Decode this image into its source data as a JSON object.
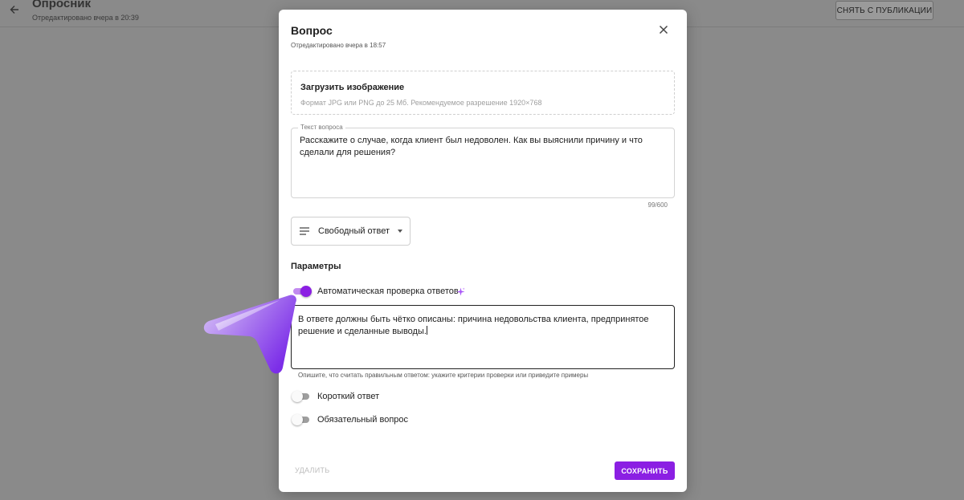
{
  "background": {
    "title": "Опросник",
    "subtitle": "Отредактировано вчера в 20:39",
    "unpublish_label": "СНЯТЬ С ПУБЛИКАЦИИ"
  },
  "modal": {
    "title": "Вопрос",
    "subtitle": "Отредактировано вчера в 18:57",
    "upload": {
      "title": "Загрузить изображение",
      "hint": "Формат JPG или PNG до 25 Мб. Рекомендуемое разрешение 1920×768"
    },
    "question": {
      "label": "Текст вопроса",
      "value": "Расскажите о случае, когда клиент был недоволен. Как вы выяснили причину и что сделали для решения?",
      "counter": "99/600"
    },
    "answer_type": {
      "icon": "lines-icon",
      "selected": "Свободный ответ"
    },
    "params": {
      "title": "Параметры",
      "auto_check": {
        "label": "Автоматическая проверка ответов",
        "enabled": true
      },
      "criteria": {
        "value": "В ответе должны быть чётко описаны: причина недовольства клиента, предпринятое решение и сделанные выводы.",
        "hint": "Опишите, что считать правильным ответом: укажите критерии проверки или приведите примеры"
      },
      "short_answer": {
        "label": "Короткий ответ",
        "enabled": false
      },
      "required": {
        "label": "Обязательный вопрос",
        "enabled": false
      }
    },
    "actions": {
      "delete_label": "УДАЛИТЬ",
      "save_label": "СОХРАНИТЬ"
    }
  },
  "colors": {
    "accent": "#8b1fe3",
    "overlay": "#8a8a8a"
  }
}
